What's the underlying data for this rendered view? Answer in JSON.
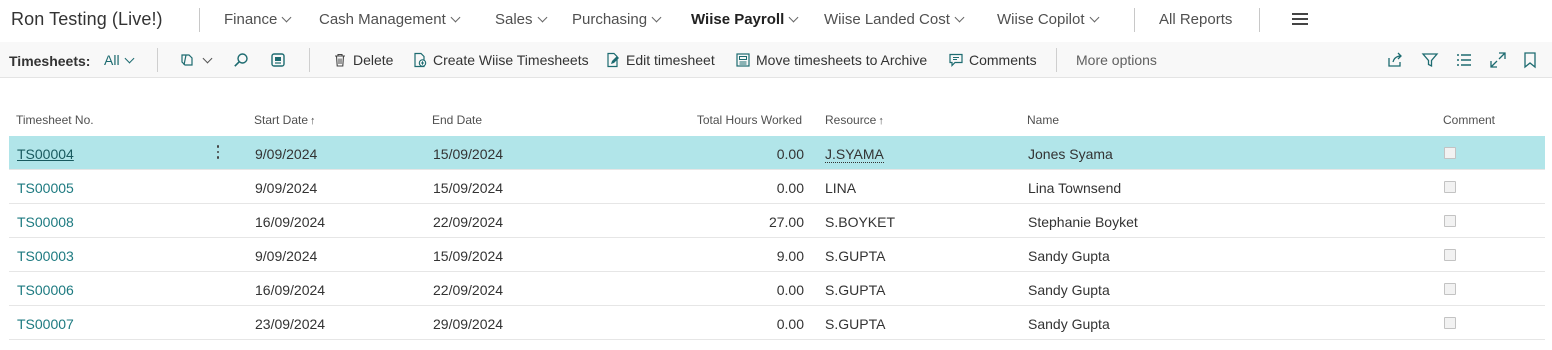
{
  "company": "Ron Testing (Live!)",
  "nav": [
    {
      "label": "Finance",
      "bold": false
    },
    {
      "label": "Cash Management",
      "bold": false
    },
    {
      "label": "Sales",
      "bold": false
    },
    {
      "label": "Purchasing",
      "bold": false
    },
    {
      "label": "Wiise Payroll",
      "bold": true
    },
    {
      "label": "Wiise Landed Cost",
      "bold": false
    },
    {
      "label": "Wiise Copilot",
      "bold": false
    }
  ],
  "all_reports": "All Reports",
  "actionbar": {
    "page_label": "Timesheets:",
    "filter_view": "All",
    "delete": "Delete",
    "create": "Create Wiise Timesheets",
    "edit": "Edit timesheet",
    "archive": "Move timesheets to Archive",
    "comments": "Comments",
    "more": "More options"
  },
  "columns": {
    "no": "Timesheet No.",
    "start": "Start Date",
    "end": "End Date",
    "hours": "Total Hours Worked",
    "resource": "Resource",
    "name": "Name",
    "comment": "Comment"
  },
  "rows": [
    {
      "no": "TS00004",
      "start": "9/09/2024",
      "end": "15/09/2024",
      "hours": "0.00",
      "resource": "J.SYAMA",
      "name": "Jones Syama",
      "comment": false,
      "selected": true
    },
    {
      "no": "TS00005",
      "start": "9/09/2024",
      "end": "15/09/2024",
      "hours": "0.00",
      "resource": "LINA",
      "name": "Lina Townsend",
      "comment": false,
      "selected": false
    },
    {
      "no": "TS00008",
      "start": "16/09/2024",
      "end": "22/09/2024",
      "hours": "27.00",
      "resource": "S.BOYKET",
      "name": "Stephanie Boyket",
      "comment": false,
      "selected": false
    },
    {
      "no": "TS00003",
      "start": "9/09/2024",
      "end": "15/09/2024",
      "hours": "9.00",
      "resource": "S.GUPTA",
      "name": "Sandy Gupta",
      "comment": false,
      "selected": false
    },
    {
      "no": "TS00006",
      "start": "16/09/2024",
      "end": "22/09/2024",
      "hours": "0.00",
      "resource": "S.GUPTA",
      "name": "Sandy Gupta",
      "comment": false,
      "selected": false
    },
    {
      "no": "TS00007",
      "start": "23/09/2024",
      "end": "29/09/2024",
      "hours": "0.00",
      "resource": "S.GUPTA",
      "name": "Sandy Gupta",
      "comment": false,
      "selected": false
    }
  ],
  "colors": {
    "accent": "#1d7a80",
    "selected_row": "#b1e5e9"
  }
}
